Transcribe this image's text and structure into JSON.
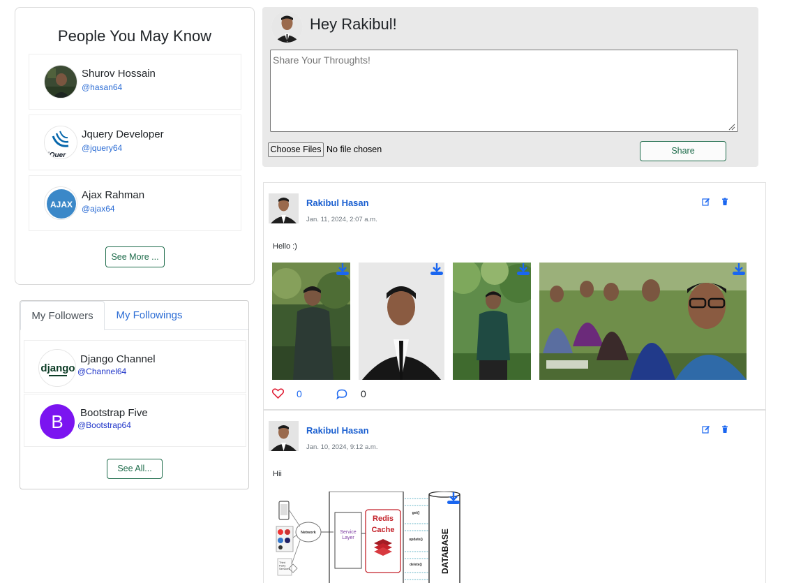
{
  "pymk": {
    "title": "People You May Know",
    "people": [
      {
        "name": "Shurov Hossain",
        "handle": "@hasan64"
      },
      {
        "name": "Jquery Developer",
        "handle": "@jquery64"
      },
      {
        "name": "Ajax Rahman",
        "handle": "@ajax64"
      }
    ],
    "see_more": "See More ...",
    "jquery_logo_text": "jQuer",
    "ajax_logo_text": "AJAX"
  },
  "follow": {
    "tab_followers": "My Followers",
    "tab_followings": "My Followings",
    "people": [
      {
        "name": "Django Channel",
        "handle": "@Channel64"
      },
      {
        "name": "Bootstrap Five",
        "handle": "@Bootstrap64"
      }
    ],
    "see_all": "See All...",
    "django_logo_text": "django",
    "bootstrap_logo_text": "B"
  },
  "composer": {
    "greeting": "Hey Rakibul!",
    "placeholder": "Share Your Throughts!",
    "choose_files": "Choose Files",
    "no_file": "No file chosen",
    "share": "Share"
  },
  "posts": [
    {
      "author": "Rakibul Hasan",
      "date": "Jan. 11, 2024, 2:07 a.m.",
      "text": "Hello :)",
      "likes": "0",
      "comments": "0"
    },
    {
      "author": "Rakibul Hasan",
      "date": "Jan. 10, 2024, 9:12 a.m.",
      "text": "Hii",
      "diagram": {
        "network": "Network",
        "service_layer": "Service\nLayer",
        "redis": "Redis",
        "cache": "Cache",
        "database": "DATABASE",
        "get": "get()",
        "update": "update()",
        "delete": "delete()",
        "third_party": "Third\nParty\nServices"
      }
    }
  ],
  "colors": {
    "accent_green": "#1d6b4a",
    "link_blue": "#2b6cd4",
    "like_red": "#e0243a",
    "icon_blue": "#1a66f0",
    "redis_red": "#c4222a"
  }
}
